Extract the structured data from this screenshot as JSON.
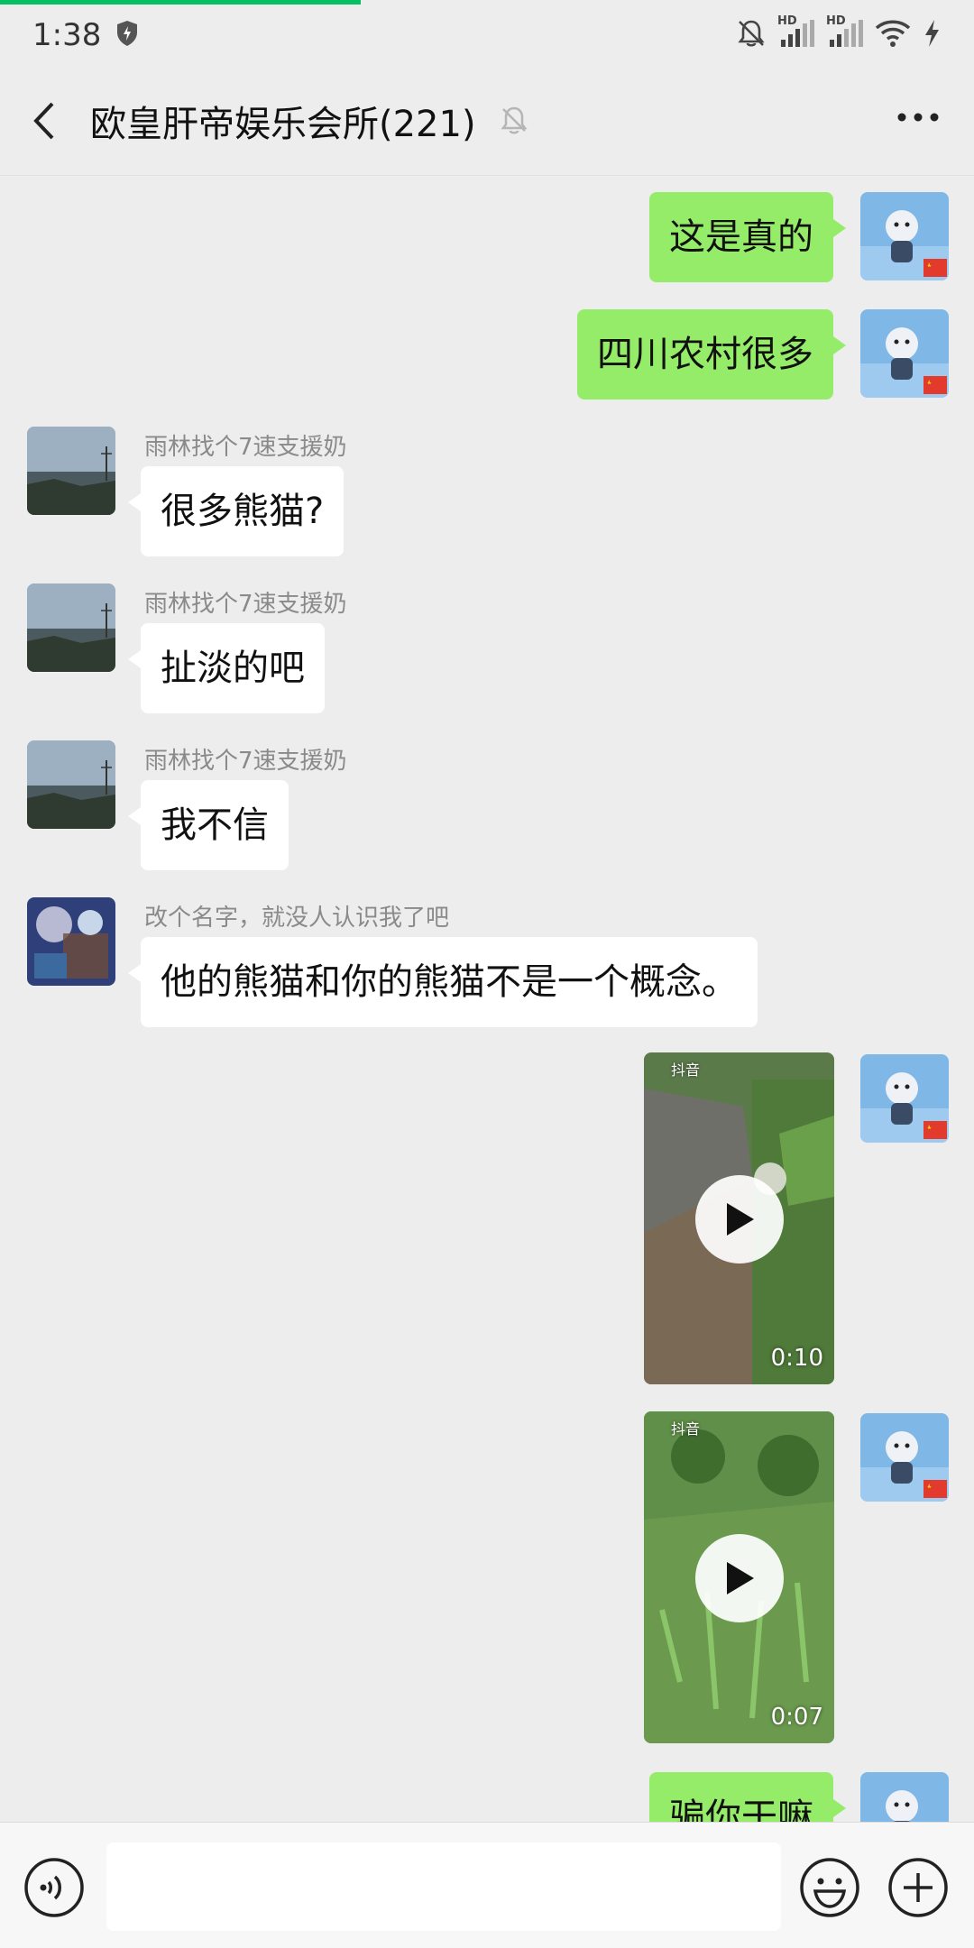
{
  "status_bar": {
    "time": "1:38",
    "network_1": "HD",
    "network_2": "HD"
  },
  "playback": {
    "progress_fraction": 0.37
  },
  "header": {
    "title": "欧皇肝帝娱乐会所(221)",
    "back_icon": "chevron-left-icon",
    "mute_icon": "bell-off-icon",
    "more_icon": "more-dots-icon"
  },
  "messages": [
    {
      "from": "self",
      "type": "text",
      "text": "这是真的"
    },
    {
      "from": "self",
      "type": "text",
      "text": "四川农村很多"
    },
    {
      "from": "other",
      "sender": "雨林找个7速支援奶",
      "type": "text",
      "text": "很多熊猫?"
    },
    {
      "from": "other",
      "sender": "雨林找个7速支援奶",
      "type": "text",
      "text": "扯淡的吧"
    },
    {
      "from": "other",
      "sender": "雨林找个7速支援奶",
      "type": "text",
      "text": "我不信"
    },
    {
      "from": "other",
      "sender": "改个名字，就没人认识我了吧",
      "type": "text",
      "text": "他的熊猫和你的熊猫不是一个概念。"
    },
    {
      "from": "self",
      "type": "video",
      "duration": "0:10",
      "brand": "抖音"
    },
    {
      "from": "self",
      "type": "video",
      "duration": "0:07",
      "brand": "抖音"
    },
    {
      "from": "self",
      "type": "text",
      "text": "骗你干嘛"
    }
  ],
  "input_bar": {
    "voice_icon": "voice-icon",
    "emoji_icon": "emoji-icon",
    "plus_icon": "plus-icon",
    "input_value": ""
  },
  "colors": {
    "self_bubble": "#95ec69",
    "other_bubble": "#ffffff",
    "background": "#ededed",
    "accent": "#07c160"
  }
}
